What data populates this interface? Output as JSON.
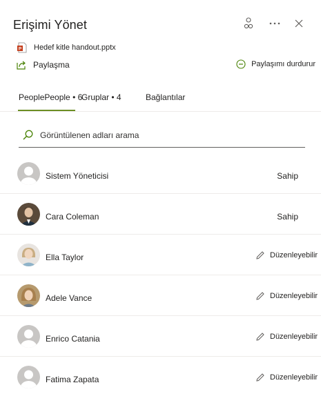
{
  "panel": {
    "title": "Erişimi Yönet",
    "file_name": "Hedef kitle handout.pptx",
    "share_label": "Paylaşma",
    "stop_sharing_label": "Paylaşımı durdurur"
  },
  "tabs": [
    {
      "label": "PeoplePeople • 6"
    },
    {
      "label": "Gruplar • 4"
    },
    {
      "label": "Bağlantılar"
    }
  ],
  "search": {
    "placeholder": "Görüntülenen adları arama"
  },
  "people": [
    {
      "name": "Sistem Yöneticisi",
      "role": "Sahip",
      "avatar": "default-avatar-icon"
    },
    {
      "name": "Cara Coleman",
      "role": "Sahip",
      "avatar": "photo"
    },
    {
      "name": "Ella Taylor",
      "role": "Düzenleyebilir",
      "avatar": "photo"
    },
    {
      "name": "Adele Vance",
      "role": "Düzenleyebilir",
      "avatar": "photo"
    },
    {
      "name": "Enrico Catania",
      "role": "Düzenleyebilir",
      "avatar": "default-avatar-icon"
    },
    {
      "name": "Fatima Zapata",
      "role": "Düzenleyebilir",
      "avatar": "default-avatar-icon"
    }
  ],
  "colors": {
    "accent": "#6b8e23",
    "powerpoint": "#c43e1c"
  }
}
